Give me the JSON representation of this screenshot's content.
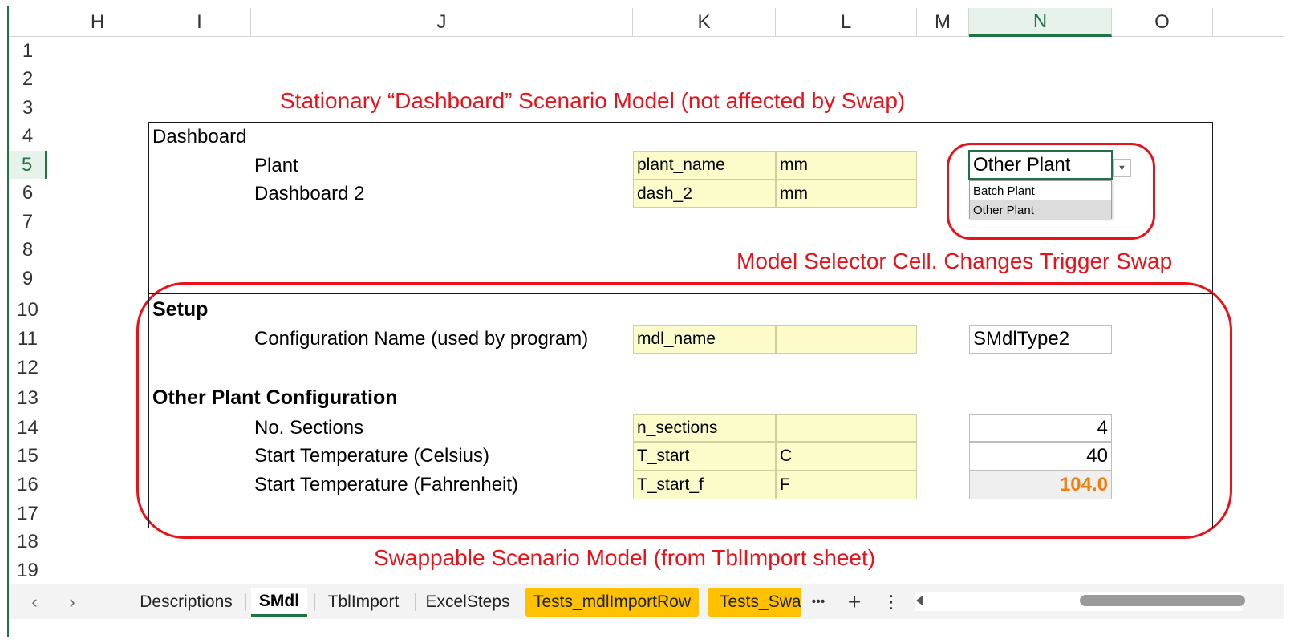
{
  "columns": [
    "H",
    "I",
    "J",
    "K",
    "L",
    "M",
    "N",
    "O"
  ],
  "rows": [
    "1",
    "2",
    "3",
    "4",
    "5",
    "6",
    "7",
    "8",
    "9",
    "10",
    "11",
    "12",
    "13",
    "14",
    "15",
    "16",
    "17",
    "18",
    "19"
  ],
  "selected_column": "N",
  "selected_row": "5",
  "annotations": {
    "top": "Stationary “Dashboard” Scenario Model (not affected by Swap)",
    "selector": "Model Selector Cell. Changes Trigger Swap",
    "bottom": "Swappable Scenario Model (from TblImport sheet)"
  },
  "dashboard": {
    "title": "Dashboard",
    "rows": [
      {
        "label": "Plant",
        "name": "plant_name",
        "unit": "mm"
      },
      {
        "label": "Dashboard 2",
        "name": "dash_2",
        "unit": "mm"
      }
    ],
    "selector_value": "Other Plant",
    "dropdown_options": [
      "Batch Plant",
      "Other Plant"
    ],
    "dropdown_highlight": "Other Plant"
  },
  "setup": {
    "title": "Setup",
    "row": {
      "label": "Configuration Name (used by program)",
      "name": "mdl_name",
      "unit": "",
      "value": "SMdlType2"
    }
  },
  "config": {
    "title": "Other Plant Configuration",
    "rows": [
      {
        "label": "No. Sections",
        "name": "n_sections",
        "unit": "",
        "value": "4"
      },
      {
        "label": "Start Temperature (Celsius)",
        "name": "T_start",
        "unit": "C",
        "value": "40"
      },
      {
        "label": "Start Temperature (Fahrenheit)",
        "name": "T_start_f",
        "unit": "F",
        "value": "104.0"
      }
    ]
  },
  "tabs": [
    {
      "label": "Descriptions"
    },
    {
      "label": "SMdl"
    },
    {
      "label": "TblImport"
    },
    {
      "label": "ExcelSteps"
    },
    {
      "label": "Tests_mdlImportRow"
    },
    {
      "label": "Tests_Swap"
    }
  ],
  "nav": {
    "prev": "‹",
    "next": "›",
    "more": "•••",
    "add": "+",
    "options": "⋮"
  },
  "colors": {
    "accent": "#217346",
    "annotation": "#e8121a",
    "input_fill": "#fcfccb",
    "tab_highlight": "#ffc000",
    "computed_text": "#f27c0c"
  }
}
